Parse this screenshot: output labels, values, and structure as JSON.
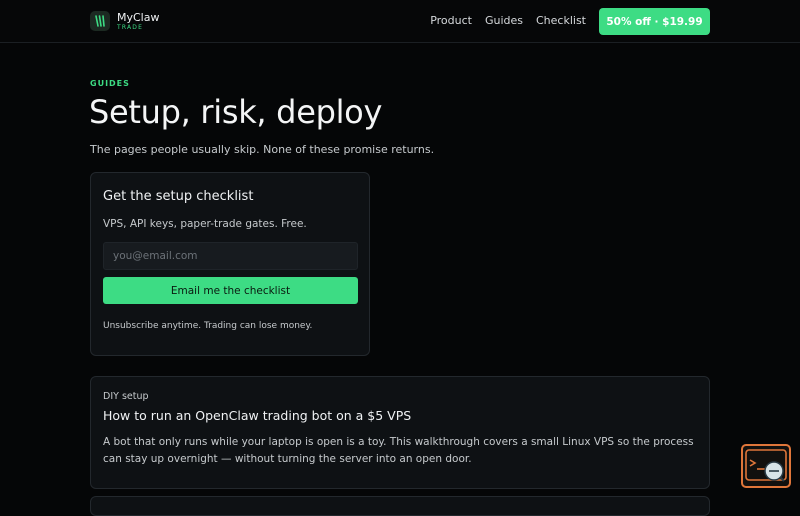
{
  "header": {
    "brand_name": "MyClaw",
    "brand_sub": "TRADE",
    "logo_icon": "claw-logo-icon",
    "nav": [
      {
        "label": "Product"
      },
      {
        "label": "Guides"
      },
      {
        "label": "Checklist"
      }
    ],
    "cta_label": "50% off · $19.99"
  },
  "hero": {
    "eyebrow": "GUIDES",
    "title": "Setup, risk, deploy",
    "lede": "The pages people usually skip. None of these promise returns."
  },
  "signup": {
    "title": "Get the setup checklist",
    "subtitle": "VPS, API keys, paper-trade gates. Free.",
    "email_placeholder": "you@email.com",
    "email_value": "",
    "submit_label": "Email me the checklist",
    "footnote": "Unsubscribe anytime. Trading can lose money."
  },
  "articles": [
    {
      "kicker": "DIY setup",
      "title": "How to run an OpenClaw trading bot on a $5 VPS",
      "body": "A bot that only runs while your laptop is open is a toy. This walkthrough covers a small Linux VPS so the process can stay up overnight — without turning the server into an open door."
    }
  ],
  "widget": {
    "icon": "chat-support-icon"
  },
  "colors": {
    "accent": "#3ddc84",
    "background": "#050607",
    "card": "#0e1114",
    "widget_border": "#e0763a"
  }
}
